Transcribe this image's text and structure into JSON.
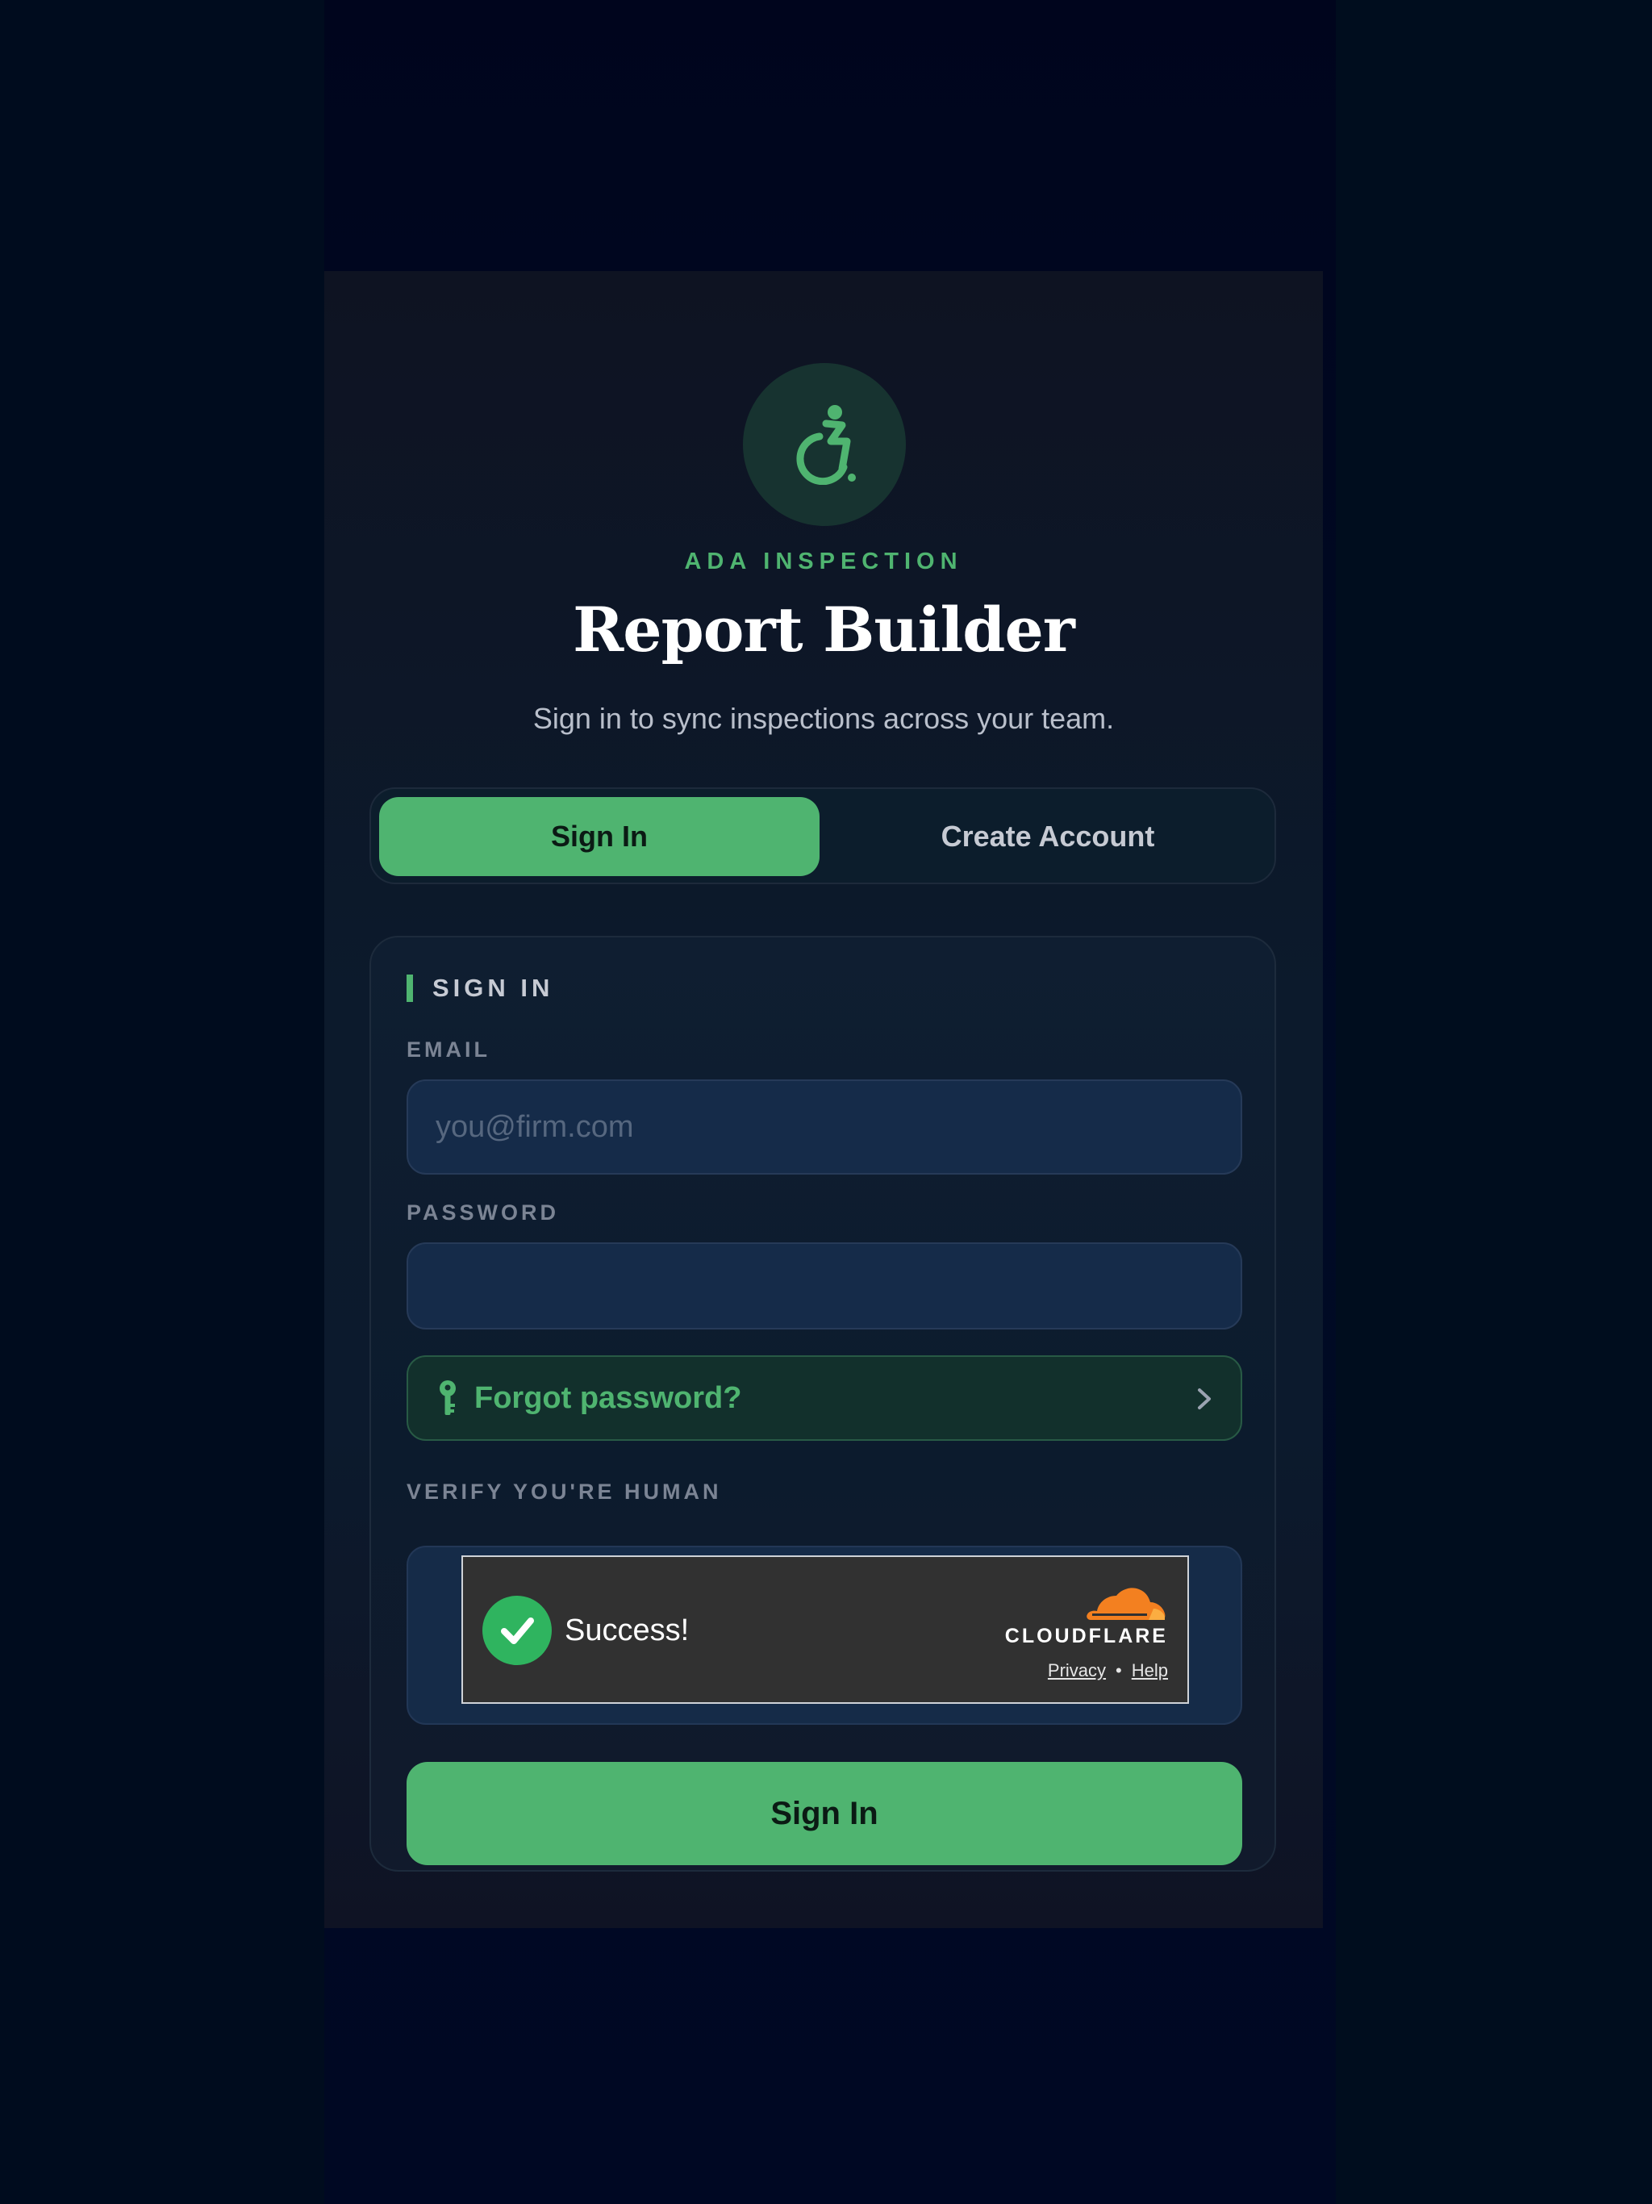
{
  "header": {
    "eyebrow": "ADA INSPECTION",
    "title": "Report Builder",
    "subtitle": "Sign in to sync inspections across your team.",
    "logo_icon": "wheelchair-accessibility-icon"
  },
  "tabs": {
    "items": [
      {
        "label": "Sign In",
        "active": true
      },
      {
        "label": "Create Account",
        "active": false
      }
    ]
  },
  "form": {
    "section_title": "SIGN IN",
    "email": {
      "label": "EMAIL",
      "placeholder": "you@firm.com",
      "value": ""
    },
    "password": {
      "label": "PASSWORD",
      "placeholder": "",
      "value": ""
    },
    "forgot": {
      "label": "Forgot password?",
      "icon": "key-icon",
      "chevron": "chevron-right-icon"
    },
    "verify": {
      "label": "VERIFY YOU'RE HUMAN",
      "widget": {
        "status": "Success!",
        "brand": "CLOUDFLARE",
        "privacy_link": "Privacy",
        "separator": "•",
        "help_link": "Help"
      }
    },
    "submit_label": "Sign In"
  },
  "colors": {
    "accent": "#4fb470",
    "background": "#000722",
    "card": "#0f1e31",
    "input": "#152b49",
    "cloudflare_orange": "#f38020",
    "success_green": "#2fb45f"
  }
}
